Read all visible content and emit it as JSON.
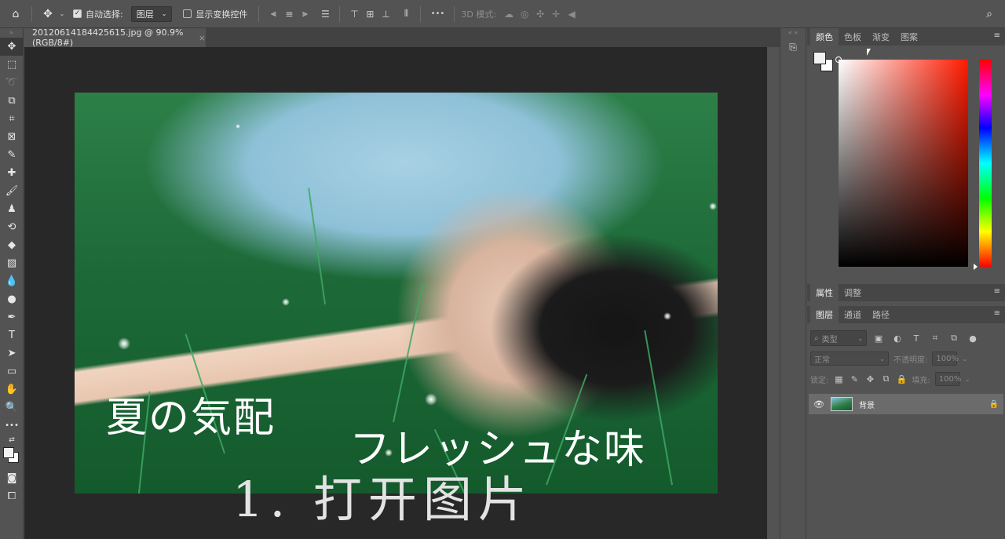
{
  "options_bar": {
    "auto_select_label": "自动选择:",
    "auto_select_value": "图层",
    "show_transform_label": "显示变换控件",
    "three_d_mode_label": "3D 模式:",
    "more_label": "•••"
  },
  "document": {
    "tab_title": "20120614184425615.jpg @ 90.9%(RGB/8#)",
    "close_glyph": "×"
  },
  "image_text": {
    "line1": "夏の気配",
    "line2": "フレッシュな味"
  },
  "overlay_caption": "1. 打开图片",
  "color_panel": {
    "tabs": [
      "颜色",
      "色板",
      "渐变",
      "图案"
    ],
    "active_tab": 0,
    "foreground": "#f2f2f2",
    "background": "#ffffff",
    "picker_hue": "#ff1a00"
  },
  "properties_panel": {
    "tabs": [
      "属性",
      "调整"
    ],
    "active_tab": 0
  },
  "layers_panel": {
    "tabs": [
      "图层",
      "通道",
      "路径"
    ],
    "active_tab": 0,
    "filter_placeholder": "类型",
    "blend_mode": "正常",
    "opacity_label": "不透明度:",
    "opacity_value": "100%",
    "lock_label": "锁定:",
    "fill_label": "填充:",
    "fill_value": "100%",
    "layers": [
      {
        "name": "背景",
        "visible": true,
        "locked": true
      }
    ]
  },
  "colors": {
    "ui_bg": "#535353",
    "canvas_bg": "#282828",
    "panel_tabs_bg": "#464646"
  }
}
